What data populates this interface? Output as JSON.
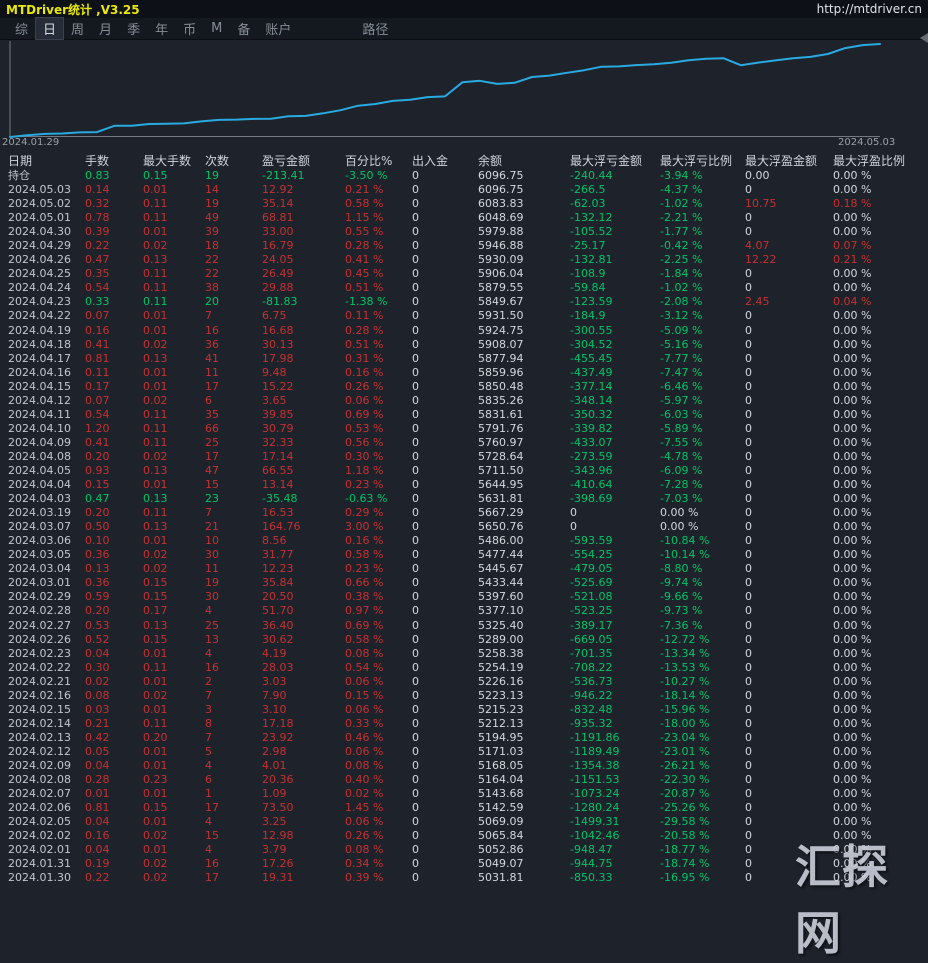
{
  "titlebar": {
    "title": "MTDriver统计 ,V3.25",
    "url": "http://mtdriver.cn"
  },
  "menu": {
    "items": [
      {
        "label": "综",
        "active": false,
        "gap": false
      },
      {
        "label": "日",
        "active": true,
        "gap": false
      },
      {
        "label": "周",
        "active": false,
        "gap": false
      },
      {
        "label": "月",
        "active": false,
        "gap": false
      },
      {
        "label": "季",
        "active": false,
        "gap": false
      },
      {
        "label": "年",
        "active": false,
        "gap": false
      },
      {
        "label": "币",
        "active": false,
        "gap": false
      },
      {
        "label": "M",
        "active": false,
        "gap": false
      },
      {
        "label": "备",
        "active": false,
        "gap": false
      },
      {
        "label": "账户",
        "active": false,
        "gap": false
      },
      {
        "label": "路径",
        "active": false,
        "gap": true
      }
    ]
  },
  "chart_data": {
    "type": "line",
    "title": "",
    "xlabel": "",
    "ylabel": "",
    "x_start_label": "2024.01.29",
    "x_end_label": "2024.05.03",
    "line_color": "#2aaae2",
    "axis_color": "#747a83",
    "start_balance": 5012.5,
    "ylim": [
      5012.5,
      6096.75
    ],
    "grid": false,
    "legend": "none",
    "dates": [
      "2024.01.30",
      "2024.01.31",
      "2024.02.01",
      "2024.02.02",
      "2024.02.05",
      "2024.02.06",
      "2024.02.07",
      "2024.02.08",
      "2024.02.09",
      "2024.02.12",
      "2024.02.13",
      "2024.02.14",
      "2024.02.15",
      "2024.02.16",
      "2024.02.21",
      "2024.02.22",
      "2024.02.23",
      "2024.02.26",
      "2024.02.27",
      "2024.02.28",
      "2024.02.29",
      "2024.03.01",
      "2024.03.04",
      "2024.03.05",
      "2024.03.06",
      "2024.03.07",
      "2024.03.19",
      "2024.04.03",
      "2024.04.04",
      "2024.04.05",
      "2024.04.08",
      "2024.04.09",
      "2024.04.10",
      "2024.04.11",
      "2024.04.12",
      "2024.04.15",
      "2024.04.16",
      "2024.04.17",
      "2024.04.18",
      "2024.04.19",
      "2024.04.22",
      "2024.04.23",
      "2024.04.24",
      "2024.04.25",
      "2024.04.26",
      "2024.04.29",
      "2024.04.30",
      "2024.05.01",
      "2024.05.02",
      "2024.05.03"
    ],
    "balances": [
      5031.81,
      5049.07,
      5052.86,
      5065.84,
      5069.09,
      5142.59,
      5143.68,
      5164.04,
      5168.05,
      5171.03,
      5194.95,
      5212.13,
      5215.23,
      5223.13,
      5226.16,
      5254.19,
      5258.38,
      5289.0,
      5325.4,
      5377.1,
      5397.6,
      5433.44,
      5445.67,
      5477.44,
      5486.0,
      5650.76,
      5667.29,
      5631.81,
      5644.95,
      5711.5,
      5728.64,
      5760.97,
      5791.76,
      5831.61,
      5835.26,
      5850.48,
      5859.96,
      5877.94,
      5908.07,
      5924.75,
      5931.5,
      5849.67,
      5879.55,
      5906.04,
      5930.09,
      5946.88,
      5979.88,
      6048.69,
      6083.83,
      6096.75
    ]
  },
  "table": {
    "columns": [
      "日期",
      "手数",
      "最大手数",
      "次数",
      "盈亏金额",
      "百分比%",
      "出入金",
      "余额",
      "最大浮亏金额",
      "最大浮亏比例",
      "最大浮盈金额",
      "最大浮盈比例"
    ],
    "rows": [
      {
        "tone": "green",
        "cells": [
          "持仓",
          "0.83",
          "0.15",
          "19",
          "-213.41",
          "-3.50 %",
          "0",
          "6096.75",
          "-240.44",
          "-3.94 %",
          "0.00",
          "0.00 %"
        ]
      },
      {
        "tone": "red",
        "cells": [
          "2024.05.03",
          "0.14",
          "0.01",
          "14",
          "12.92",
          "0.21 %",
          "0",
          "6096.75",
          "-266.5",
          "-4.37 %",
          "0",
          "0.00 %"
        ]
      },
      {
        "tone": "red",
        "cells": [
          "2024.05.02",
          "0.32",
          "0.11",
          "19",
          "35.14",
          "0.58 %",
          "0",
          "6083.83",
          "-62.03",
          "-1.02 %",
          "10.75",
          "0.18 %"
        ]
      },
      {
        "tone": "red",
        "cells": [
          "2024.05.01",
          "0.78",
          "0.11",
          "49",
          "68.81",
          "1.15 %",
          "0",
          "6048.69",
          "-132.12",
          "-2.21 %",
          "0",
          "0.00 %"
        ]
      },
      {
        "tone": "red",
        "cells": [
          "2024.04.30",
          "0.39",
          "0.01",
          "39",
          "33.00",
          "0.55 %",
          "0",
          "5979.88",
          "-105.52",
          "-1.77 %",
          "0",
          "0.00 %"
        ]
      },
      {
        "tone": "red",
        "cells": [
          "2024.04.29",
          "0.22",
          "0.02",
          "18",
          "16.79",
          "0.28 %",
          "0",
          "5946.88",
          "-25.17",
          "-0.42 %",
          "4.07",
          "0.07 %"
        ]
      },
      {
        "tone": "red",
        "cells": [
          "2024.04.26",
          "0.47",
          "0.13",
          "22",
          "24.05",
          "0.41 %",
          "0",
          "5930.09",
          "-132.81",
          "-2.25 %",
          "12.22",
          "0.21 %"
        ]
      },
      {
        "tone": "red",
        "cells": [
          "2024.04.25",
          "0.35",
          "0.11",
          "22",
          "26.49",
          "0.45 %",
          "0",
          "5906.04",
          "-108.9",
          "-1.84 %",
          "0",
          "0.00 %"
        ]
      },
      {
        "tone": "red",
        "cells": [
          "2024.04.24",
          "0.54",
          "0.11",
          "38",
          "29.88",
          "0.51 %",
          "0",
          "5879.55",
          "-59.84",
          "-1.02 %",
          "0",
          "0.00 %"
        ]
      },
      {
        "tone": "green",
        "cells": [
          "2024.04.23",
          "0.33",
          "0.11",
          "20",
          "-81.83",
          "-1.38 %",
          "0",
          "5849.67",
          "-123.59",
          "-2.08 %",
          "2.45",
          "0.04 %"
        ]
      },
      {
        "tone": "red",
        "cells": [
          "2024.04.22",
          "0.07",
          "0.01",
          "7",
          "6.75",
          "0.11 %",
          "0",
          "5931.50",
          "-184.9",
          "-3.12 %",
          "0",
          "0.00 %"
        ]
      },
      {
        "tone": "red",
        "cells": [
          "2024.04.19",
          "0.16",
          "0.01",
          "16",
          "16.68",
          "0.28 %",
          "0",
          "5924.75",
          "-300.55",
          "-5.09 %",
          "0",
          "0.00 %"
        ]
      },
      {
        "tone": "red",
        "cells": [
          "2024.04.18",
          "0.41",
          "0.02",
          "36",
          "30.13",
          "0.51 %",
          "0",
          "5908.07",
          "-304.52",
          "-5.16 %",
          "0",
          "0.00 %"
        ]
      },
      {
        "tone": "red",
        "cells": [
          "2024.04.17",
          "0.81",
          "0.13",
          "41",
          "17.98",
          "0.31 %",
          "0",
          "5877.94",
          "-455.45",
          "-7.77 %",
          "0",
          "0.00 %"
        ]
      },
      {
        "tone": "red",
        "cells": [
          "2024.04.16",
          "0.11",
          "0.01",
          "11",
          "9.48",
          "0.16 %",
          "0",
          "5859.96",
          "-437.49",
          "-7.47 %",
          "0",
          "0.00 %"
        ]
      },
      {
        "tone": "red",
        "cells": [
          "2024.04.15",
          "0.17",
          "0.01",
          "17",
          "15.22",
          "0.26 %",
          "0",
          "5850.48",
          "-377.14",
          "-6.46 %",
          "0",
          "0.00 %"
        ]
      },
      {
        "tone": "red",
        "cells": [
          "2024.04.12",
          "0.07",
          "0.02",
          "6",
          "3.65",
          "0.06 %",
          "0",
          "5835.26",
          "-348.14",
          "-5.97 %",
          "0",
          "0.00 %"
        ]
      },
      {
        "tone": "red",
        "cells": [
          "2024.04.11",
          "0.54",
          "0.11",
          "35",
          "39.85",
          "0.69 %",
          "0",
          "5831.61",
          "-350.32",
          "-6.03 %",
          "0",
          "0.00 %"
        ]
      },
      {
        "tone": "red",
        "cells": [
          "2024.04.10",
          "1.20",
          "0.11",
          "66",
          "30.79",
          "0.53 %",
          "0",
          "5791.76",
          "-339.82",
          "-5.89 %",
          "0",
          "0.00 %"
        ]
      },
      {
        "tone": "red",
        "cells": [
          "2024.04.09",
          "0.41",
          "0.11",
          "25",
          "32.33",
          "0.56 %",
          "0",
          "5760.97",
          "-433.07",
          "-7.55 %",
          "0",
          "0.00 %"
        ]
      },
      {
        "tone": "red",
        "cells": [
          "2024.04.08",
          "0.20",
          "0.02",
          "17",
          "17.14",
          "0.30 %",
          "0",
          "5728.64",
          "-273.59",
          "-4.78 %",
          "0",
          "0.00 %"
        ]
      },
      {
        "tone": "red",
        "cells": [
          "2024.04.05",
          "0.93",
          "0.13",
          "47",
          "66.55",
          "1.18 %",
          "0",
          "5711.50",
          "-343.96",
          "-6.09 %",
          "0",
          "0.00 %"
        ]
      },
      {
        "tone": "red",
        "cells": [
          "2024.04.04",
          "0.15",
          "0.01",
          "15",
          "13.14",
          "0.23 %",
          "0",
          "5644.95",
          "-410.64",
          "-7.28 %",
          "0",
          "0.00 %"
        ]
      },
      {
        "tone": "green",
        "cells": [
          "2024.04.03",
          "0.47",
          "0.13",
          "23",
          "-35.48",
          "-0.63 %",
          "0",
          "5631.81",
          "-398.69",
          "-7.03 %",
          "0",
          "0.00 %"
        ]
      },
      {
        "tone": "red",
        "cells": [
          "2024.03.19",
          "0.20",
          "0.11",
          "7",
          "16.53",
          "0.29 %",
          "0",
          "5667.29",
          "0",
          "0.00 %",
          "0",
          "0.00 %"
        ]
      },
      {
        "tone": "red",
        "cells": [
          "2024.03.07",
          "0.50",
          "0.13",
          "21",
          "164.76",
          "3.00 %",
          "0",
          "5650.76",
          "0",
          "0.00 %",
          "0",
          "0.00 %"
        ]
      },
      {
        "tone": "red",
        "cells": [
          "2024.03.06",
          "0.10",
          "0.01",
          "10",
          "8.56",
          "0.16 %",
          "0",
          "5486.00",
          "-593.59",
          "-10.84 %",
          "0",
          "0.00 %"
        ]
      },
      {
        "tone": "red",
        "cells": [
          "2024.03.05",
          "0.36",
          "0.02",
          "30",
          "31.77",
          "0.58 %",
          "0",
          "5477.44",
          "-554.25",
          "-10.14 %",
          "0",
          "0.00 %"
        ]
      },
      {
        "tone": "red",
        "cells": [
          "2024.03.04",
          "0.13",
          "0.02",
          "11",
          "12.23",
          "0.23 %",
          "0",
          "5445.67",
          "-479.05",
          "-8.80 %",
          "0",
          "0.00 %"
        ]
      },
      {
        "tone": "red",
        "cells": [
          "2024.03.01",
          "0.36",
          "0.15",
          "19",
          "35.84",
          "0.66 %",
          "0",
          "5433.44",
          "-525.69",
          "-9.74 %",
          "0",
          "0.00 %"
        ]
      },
      {
        "tone": "red",
        "cells": [
          "2024.02.29",
          "0.59",
          "0.15",
          "30",
          "20.50",
          "0.38 %",
          "0",
          "5397.60",
          "-521.08",
          "-9.66 %",
          "0",
          "0.00 %"
        ]
      },
      {
        "tone": "red",
        "cells": [
          "2024.02.28",
          "0.20",
          "0.17",
          "4",
          "51.70",
          "0.97 %",
          "0",
          "5377.10",
          "-523.25",
          "-9.73 %",
          "0",
          "0.00 %"
        ]
      },
      {
        "tone": "red",
        "cells": [
          "2024.02.27",
          "0.53",
          "0.13",
          "25",
          "36.40",
          "0.69 %",
          "0",
          "5325.40",
          "-389.17",
          "-7.36 %",
          "0",
          "0.00 %"
        ]
      },
      {
        "tone": "red",
        "cells": [
          "2024.02.26",
          "0.52",
          "0.15",
          "13",
          "30.62",
          "0.58 %",
          "0",
          "5289.00",
          "-669.05",
          "-12.72 %",
          "0",
          "0.00 %"
        ]
      },
      {
        "tone": "red",
        "cells": [
          "2024.02.23",
          "0.04",
          "0.01",
          "4",
          "4.19",
          "0.08 %",
          "0",
          "5258.38",
          "-701.35",
          "-13.34 %",
          "0",
          "0.00 %"
        ]
      },
      {
        "tone": "red",
        "cells": [
          "2024.02.22",
          "0.30",
          "0.11",
          "16",
          "28.03",
          "0.54 %",
          "0",
          "5254.19",
          "-708.22",
          "-13.53 %",
          "0",
          "0.00 %"
        ]
      },
      {
        "tone": "red",
        "cells": [
          "2024.02.21",
          "0.02",
          "0.01",
          "2",
          "3.03",
          "0.06 %",
          "0",
          "5226.16",
          "-536.73",
          "-10.27 %",
          "0",
          "0.00 %"
        ]
      },
      {
        "tone": "red",
        "cells": [
          "2024.02.16",
          "0.08",
          "0.02",
          "7",
          "7.90",
          "0.15 %",
          "0",
          "5223.13",
          "-946.22",
          "-18.14 %",
          "0",
          "0.00 %"
        ]
      },
      {
        "tone": "red",
        "cells": [
          "2024.02.15",
          "0.03",
          "0.01",
          "3",
          "3.10",
          "0.06 %",
          "0",
          "5215.23",
          "-832.48",
          "-15.96 %",
          "0",
          "0.00 %"
        ]
      },
      {
        "tone": "red",
        "cells": [
          "2024.02.14",
          "0.21",
          "0.11",
          "8",
          "17.18",
          "0.33 %",
          "0",
          "5212.13",
          "-935.32",
          "-18.00 %",
          "0",
          "0.00 %"
        ]
      },
      {
        "tone": "red",
        "cells": [
          "2024.02.13",
          "0.42",
          "0.20",
          "7",
          "23.92",
          "0.46 %",
          "0",
          "5194.95",
          "-1191.86",
          "-23.04 %",
          "0",
          "0.00 %"
        ]
      },
      {
        "tone": "red",
        "cells": [
          "2024.02.12",
          "0.05",
          "0.01",
          "5",
          "2.98",
          "0.06 %",
          "0",
          "5171.03",
          "-1189.49",
          "-23.01 %",
          "0",
          "0.00 %"
        ]
      },
      {
        "tone": "red",
        "cells": [
          "2024.02.09",
          "0.04",
          "0.01",
          "4",
          "4.01",
          "0.08 %",
          "0",
          "5168.05",
          "-1354.38",
          "-26.21 %",
          "0",
          "0.00 %"
        ]
      },
      {
        "tone": "red",
        "cells": [
          "2024.02.08",
          "0.28",
          "0.23",
          "6",
          "20.36",
          "0.40 %",
          "0",
          "5164.04",
          "-1151.53",
          "-22.30 %",
          "0",
          "0.00 %"
        ]
      },
      {
        "tone": "red",
        "cells": [
          "2024.02.07",
          "0.01",
          "0.01",
          "1",
          "1.09",
          "0.02 %",
          "0",
          "5143.68",
          "-1073.24",
          "-20.87 %",
          "0",
          "0.00 %"
        ]
      },
      {
        "tone": "red",
        "cells": [
          "2024.02.06",
          "0.81",
          "0.15",
          "17",
          "73.50",
          "1.45 %",
          "0",
          "5142.59",
          "-1280.24",
          "-25.26 %",
          "0",
          "0.00 %"
        ]
      },
      {
        "tone": "red",
        "cells": [
          "2024.02.05",
          "0.04",
          "0.01",
          "4",
          "3.25",
          "0.06 %",
          "0",
          "5069.09",
          "-1499.31",
          "-29.58 %",
          "0",
          "0.00 %"
        ]
      },
      {
        "tone": "red",
        "cells": [
          "2024.02.02",
          "0.16",
          "0.02",
          "15",
          "12.98",
          "0.26 %",
          "0",
          "5065.84",
          "-1042.46",
          "-20.58 %",
          "0",
          "0.00 %"
        ]
      },
      {
        "tone": "red",
        "cells": [
          "2024.02.01",
          "0.04",
          "0.01",
          "4",
          "3.79",
          "0.08 %",
          "0",
          "5052.86",
          "-948.47",
          "-18.77 %",
          "0",
          "0.00 %"
        ]
      },
      {
        "tone": "red",
        "cells": [
          "2024.01.31",
          "0.19",
          "0.02",
          "16",
          "17.26",
          "0.34 %",
          "0",
          "5049.07",
          "-944.75",
          "-18.74 %",
          "0",
          "0.00 %"
        ]
      },
      {
        "tone": "red",
        "cells": [
          "2024.01.30",
          "0.22",
          "0.02",
          "17",
          "19.31",
          "0.39 %",
          "0",
          "5031.81",
          "-850.33",
          "-16.95 %",
          "0",
          "0.00 %"
        ]
      }
    ]
  },
  "watermark": "汇探网",
  "colors": {
    "profit_red": "#c63232",
    "loss_green": "#00c468",
    "line_blue": "#2aaae2",
    "title_yellow": "#e9e903",
    "background": "#1e222a"
  }
}
